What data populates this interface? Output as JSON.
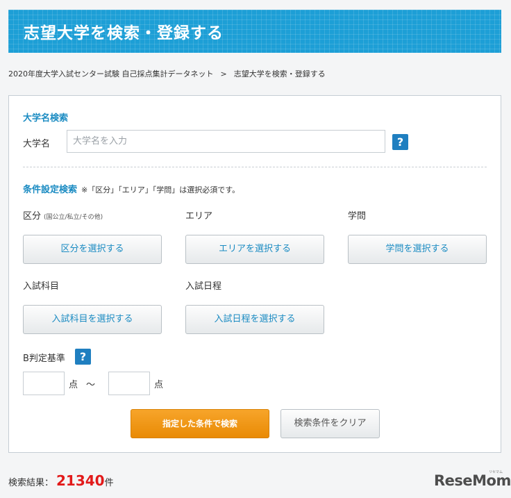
{
  "banner": {
    "title": "志望大学を検索・登録する"
  },
  "breadcrumb": {
    "home": "2020年度大学入試センター試験 自己採点集計データネット",
    "separator": ">",
    "current": "志望大学を検索・登録する"
  },
  "name_search": {
    "title": "大学名検索",
    "label": "大学名",
    "value": "",
    "placeholder": "大学名を入力",
    "help": "?"
  },
  "condition_search": {
    "title": "条件設定検索",
    "note": "※「区分」「エリア」「学問」は選択必須です。",
    "division": {
      "label": "区分",
      "sublabel": "(国公立/私立/その他)",
      "button": "区分を選択する"
    },
    "area": {
      "label": "エリア",
      "button": "エリアを選択する"
    },
    "field": {
      "label": "学問",
      "button": "学問を選択する"
    },
    "subjects": {
      "label": "入試科目",
      "button": "入試科目を選択する"
    },
    "schedule": {
      "label": "入試日程",
      "button": "入試日程を選択する"
    },
    "b_judgment": {
      "label": "B判定基準",
      "help": "?",
      "min_value": "",
      "max_value": "",
      "unit": "点",
      "range_separator": "〜"
    }
  },
  "actions": {
    "search": "指定した条件で検索",
    "clear": "検索条件をクリア"
  },
  "results": {
    "label": "検索結果：",
    "count": "21340",
    "suffix": "件"
  },
  "logo": {
    "text": "ReseMom",
    "sub": "リセマム"
  },
  "colors": {
    "banner": "#1d9fd6",
    "accent": "#1a8bc2",
    "search_button": "#f0960f",
    "count": "#e21a1a"
  }
}
